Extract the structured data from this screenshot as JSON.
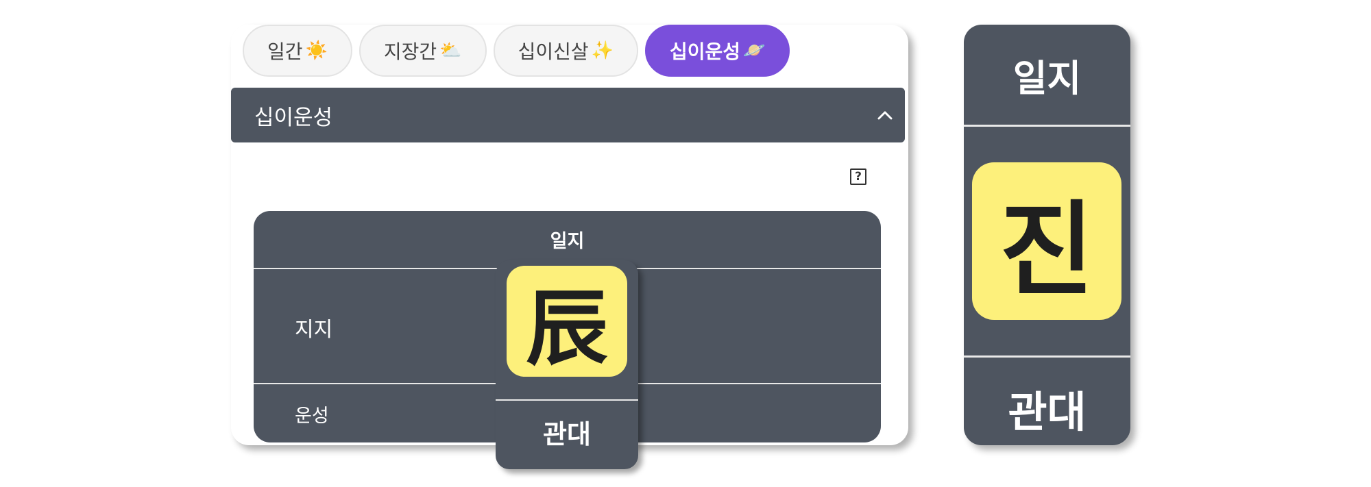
{
  "tabs": [
    {
      "label": "일간",
      "emoji": "☀️",
      "active": false
    },
    {
      "label": "지장간",
      "emoji": "⛅",
      "active": false
    },
    {
      "label": "십이신살",
      "emoji": "✨",
      "active": false
    },
    {
      "label": "십이운성",
      "emoji": "🪐",
      "active": true
    }
  ],
  "section": {
    "title": "십이운성"
  },
  "help": {
    "symbol": "?"
  },
  "table": {
    "column_header": "일지",
    "row_labels": {
      "branch": "지지",
      "fortune": "운성"
    },
    "cell": {
      "branch_char": "辰",
      "fortune": "관대"
    }
  },
  "zoom": {
    "header": "일지",
    "branch_char": "진",
    "fortune": "관대"
  },
  "colors": {
    "panel": "#4e5560",
    "tile": "#fdf07b",
    "active_tab": "#7a4fdb"
  }
}
